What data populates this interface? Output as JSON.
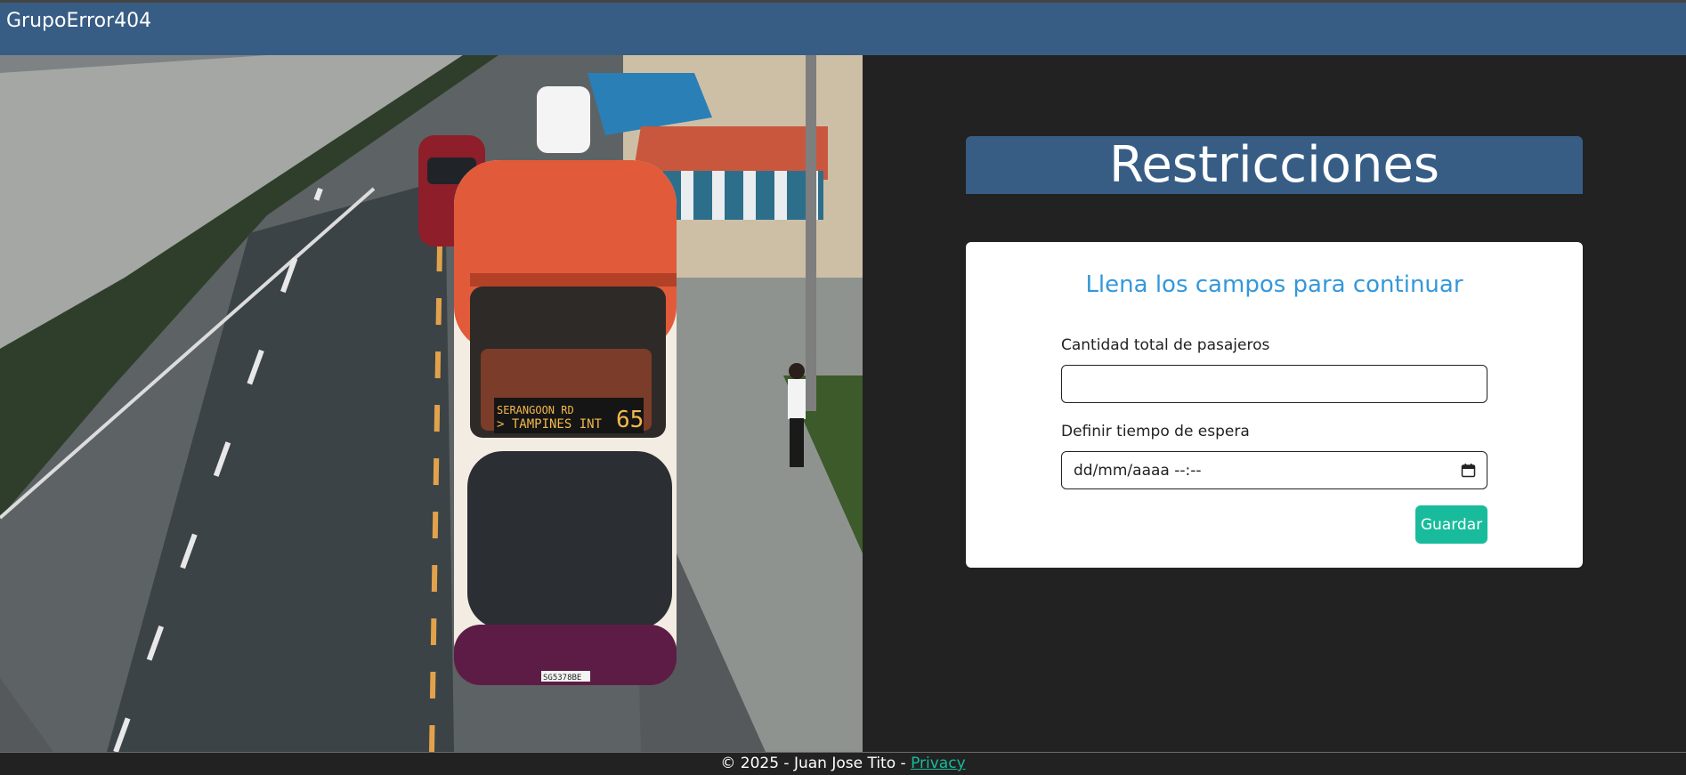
{
  "navbar": {
    "brand": "GrupoError404"
  },
  "photo": {
    "alt": "Double-decker bus on a city road",
    "bus_destination_line1": "SERANGOON RD",
    "bus_destination_line2": "> TAMPINES INT",
    "bus_route": "65",
    "bus_plate": "SG5378BE"
  },
  "form": {
    "title": "Restricciones",
    "subtitle": "Llena los campos para continuar",
    "passengers": {
      "label": "Cantidad total de pasajeros",
      "value": ""
    },
    "wait_time": {
      "label": "Definir tiempo de espera",
      "value": "dd/mm/aaaa --:--"
    },
    "save_label": "Guardar"
  },
  "footer": {
    "text": "© 2025 - Juan Jose Tito - ",
    "privacy_label": "Privacy"
  },
  "colors": {
    "navbar": "#385d85",
    "background": "#222222",
    "accent": "#3498db",
    "button": "#18bc9c"
  },
  "icons": {
    "calendar": "calendar-icon"
  }
}
